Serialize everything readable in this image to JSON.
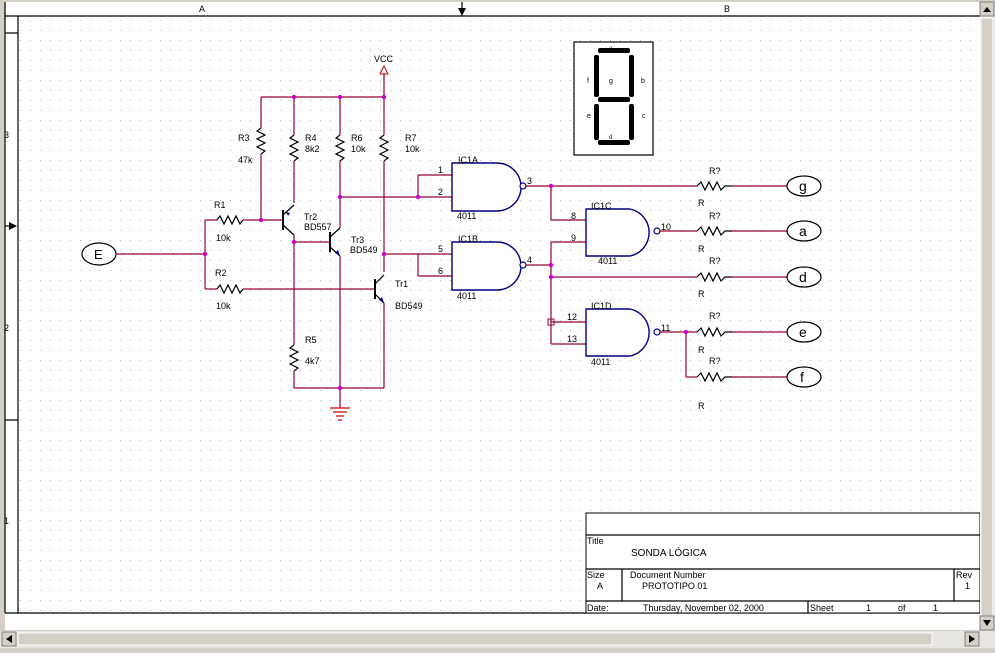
{
  "ruler": {
    "col_a": "A",
    "col_b": "B",
    "row_3": "3",
    "row_2": "2",
    "row_1": "1"
  },
  "supply": {
    "vcc": "VCC"
  },
  "resistors": {
    "r1": {
      "name": "R1",
      "value": "10k"
    },
    "r2": {
      "name": "R2",
      "value": "10k"
    },
    "r3": {
      "name": "R3",
      "value": "47k"
    },
    "r4": {
      "name": "R4",
      "value": "8k2"
    },
    "r5": {
      "name": "R5",
      "value": "4k7"
    },
    "r6": {
      "name": "R6",
      "value": "10k"
    },
    "r7": {
      "name": "R7",
      "value": "10k"
    },
    "out_name": "R?",
    "out_value": "R"
  },
  "transistors": {
    "tr1": {
      "name": "Tr1",
      "part": "BD549"
    },
    "tr2": {
      "name": "Tr2",
      "part": "BD557"
    },
    "tr3": {
      "name": "Tr3",
      "part": "BD549"
    }
  },
  "gates": {
    "ic1a": {
      "name": "IC1A",
      "part": "4011",
      "in1": "1",
      "in2": "2",
      "out": "3"
    },
    "ic1b": {
      "name": "IC1B",
      "part": "4011",
      "in1": "5",
      "in2": "6",
      "out": "4"
    },
    "ic1c": {
      "name": "IC1C",
      "part": "4011",
      "in1": "8",
      "in2": "9",
      "out": "10"
    },
    "ic1d": {
      "name": "IC1D",
      "part": "4011",
      "in1": "12",
      "in2": "13",
      "out": "11"
    }
  },
  "ports": {
    "input": "E",
    "g": "g",
    "a": "a",
    "d": "d",
    "e": "e",
    "f": "f"
  },
  "display": {
    "seg_a": "a",
    "seg_b": "b",
    "seg_c": "c",
    "seg_d": "d",
    "seg_e": "e",
    "seg_f": "f",
    "seg_g": "g"
  },
  "title_block": {
    "title_label": "Title",
    "title": "SONDA LÓGICA",
    "size_label": "Size",
    "size": "A",
    "docnum_label": "Document Number",
    "docnum": "PROTOTIPO 01",
    "rev_label": "Rev",
    "rev": "1",
    "date_label": "Date:",
    "date": "Thursday, November 02, 2000",
    "sheet_label": "Sheet",
    "sheet": "1",
    "of_label": "of",
    "of": "1"
  },
  "colors": {
    "wire": "#990033",
    "gate": "#000080",
    "junction": "#cc00cc",
    "grid": "#b0b0b0"
  }
}
